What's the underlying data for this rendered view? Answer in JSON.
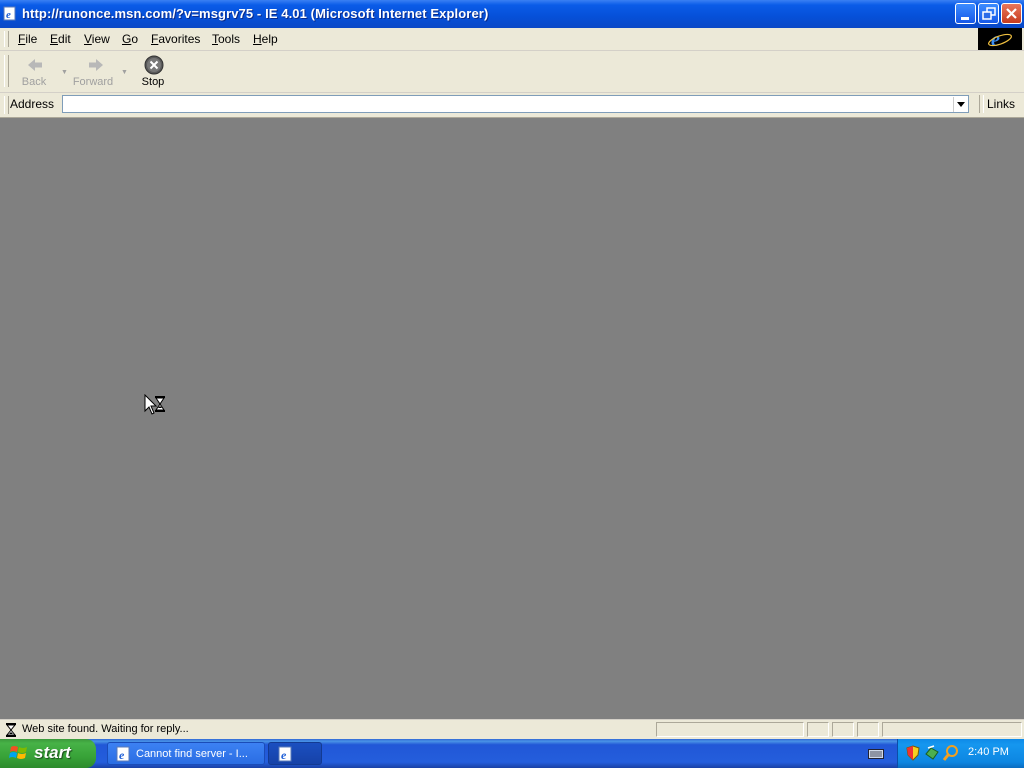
{
  "window": {
    "title": "http://runonce.msn.com/?v=msgrv75 - IE 4.01 (Microsoft Internet Explorer)"
  },
  "menu": {
    "items": [
      {
        "label": "File",
        "mnemonic": "F",
        "rest": "ile"
      },
      {
        "label": "Edit",
        "mnemonic": "E",
        "rest": "dit"
      },
      {
        "label": "View",
        "mnemonic": "V",
        "rest": "iew"
      },
      {
        "label": "Go",
        "mnemonic": "G",
        "rest": "o"
      },
      {
        "label": "Favorites",
        "mnemonic": "F",
        "rest": "avorites",
        "pre": ""
      },
      {
        "label": "Tools",
        "mnemonic": "T",
        "rest": "ools"
      },
      {
        "label": "Help",
        "mnemonic": "H",
        "rest": "elp"
      }
    ]
  },
  "toolbar": {
    "back_label": "Back",
    "forward_label": "Forward",
    "stop_label": "Stop"
  },
  "address": {
    "label": "Address",
    "value": "",
    "links_label": "Links"
  },
  "status": {
    "text": "Web site found. Waiting for reply..."
  },
  "taskbar": {
    "start_label": "start",
    "tasks": [
      {
        "label": "Cannot find server - I..."
      },
      {
        "label": ""
      }
    ],
    "clock": "2:40 PM"
  },
  "colors": {
    "titlebar": "#0650d8",
    "content_bg": "#808080",
    "chrome_bg": "#ece9d8",
    "start_green": "#38a338",
    "taskbar_blue": "#245edc"
  }
}
